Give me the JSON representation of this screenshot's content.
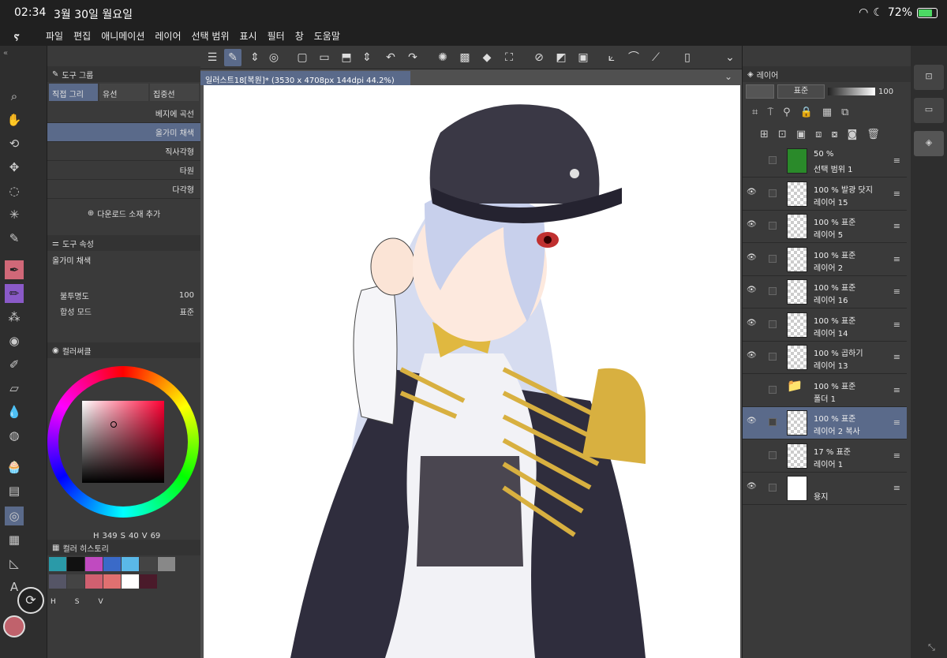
{
  "status": {
    "time": "02:34",
    "date": "3월 30일 월요일",
    "battery": "72%"
  },
  "menu": [
    "파일",
    "편집",
    "애니메이션",
    "레이어",
    "선택 범위",
    "표시",
    "필터",
    "창",
    "도움말"
  ],
  "tool_group": {
    "title": "도구 그룹",
    "tabs": [
      "직접 그리",
      "유선",
      "집중선"
    ],
    "items": [
      "베지에 곡선",
      "올가미 채색",
      "직사각형",
      "타원",
      "다각형"
    ],
    "add_material": "다운로드 소재 추가"
  },
  "tool_props": {
    "title": "도구 속성",
    "tool_name": "올가미 채색",
    "opacity_label": "불투명도",
    "opacity_value": "100",
    "blend_label": "합성 모드",
    "blend_value": "표준"
  },
  "color_circle": {
    "title": "컬러써클",
    "h_label": "H",
    "h": "349",
    "s_label": "S",
    "s": "40",
    "v_label": "V",
    "v": "69",
    "main_color": "#c0626c"
  },
  "color_history": {
    "title": "컬러 히스토리",
    "labels": [
      "H",
      "S",
      "V"
    ],
    "swatches": [
      "#2a9aa8",
      "#111111",
      "#c04ac0",
      "#3a6ac8",
      "#5ab8e8",
      "#444444",
      "#888888",
      "#555566",
      "#444444",
      "#d06070",
      "#e07070",
      "#ffffff",
      "#4a1a2a",
      "#3a3a3a"
    ]
  },
  "document": {
    "tab": "일러스트18[복원]* (3530 x 4708px 144dpi 44.2%)"
  },
  "layers": {
    "title": "레이어",
    "blend": "표준",
    "opacity": "100",
    "rows": [
      {
        "mode": "50 %",
        "name": "선택 범위 1",
        "visible": false,
        "kind": "selection"
      },
      {
        "mode": "100 % 발광 닷지",
        "name": "레이어 15",
        "visible": true,
        "kind": "raster"
      },
      {
        "mode": "100 % 표준",
        "name": "레이어 5",
        "visible": true,
        "kind": "raster"
      },
      {
        "mode": "100 % 표준",
        "name": "레이어 2",
        "visible": true,
        "kind": "raster"
      },
      {
        "mode": "100 % 표준",
        "name": "레이어 16",
        "visible": true,
        "kind": "raster"
      },
      {
        "mode": "100 % 표준",
        "name": "레이어 14",
        "visible": true,
        "kind": "raster"
      },
      {
        "mode": "100 % 곱하기",
        "name": "레이어 13",
        "visible": true,
        "kind": "raster"
      },
      {
        "mode": "100 % 표준",
        "name": "폴더 1",
        "visible": false,
        "kind": "folder"
      },
      {
        "mode": "100 % 표준",
        "name": "레이어 2 복사",
        "visible": true,
        "kind": "active"
      },
      {
        "mode": "17 % 표준",
        "name": "레이어 1",
        "visible": false,
        "kind": "raster"
      },
      {
        "mode": "",
        "name": "용지",
        "visible": true,
        "kind": "paper"
      }
    ]
  },
  "colors": {
    "accent": "#5a6a8a",
    "panel": "#3a3a3a",
    "dark": "#2b2b2b"
  }
}
